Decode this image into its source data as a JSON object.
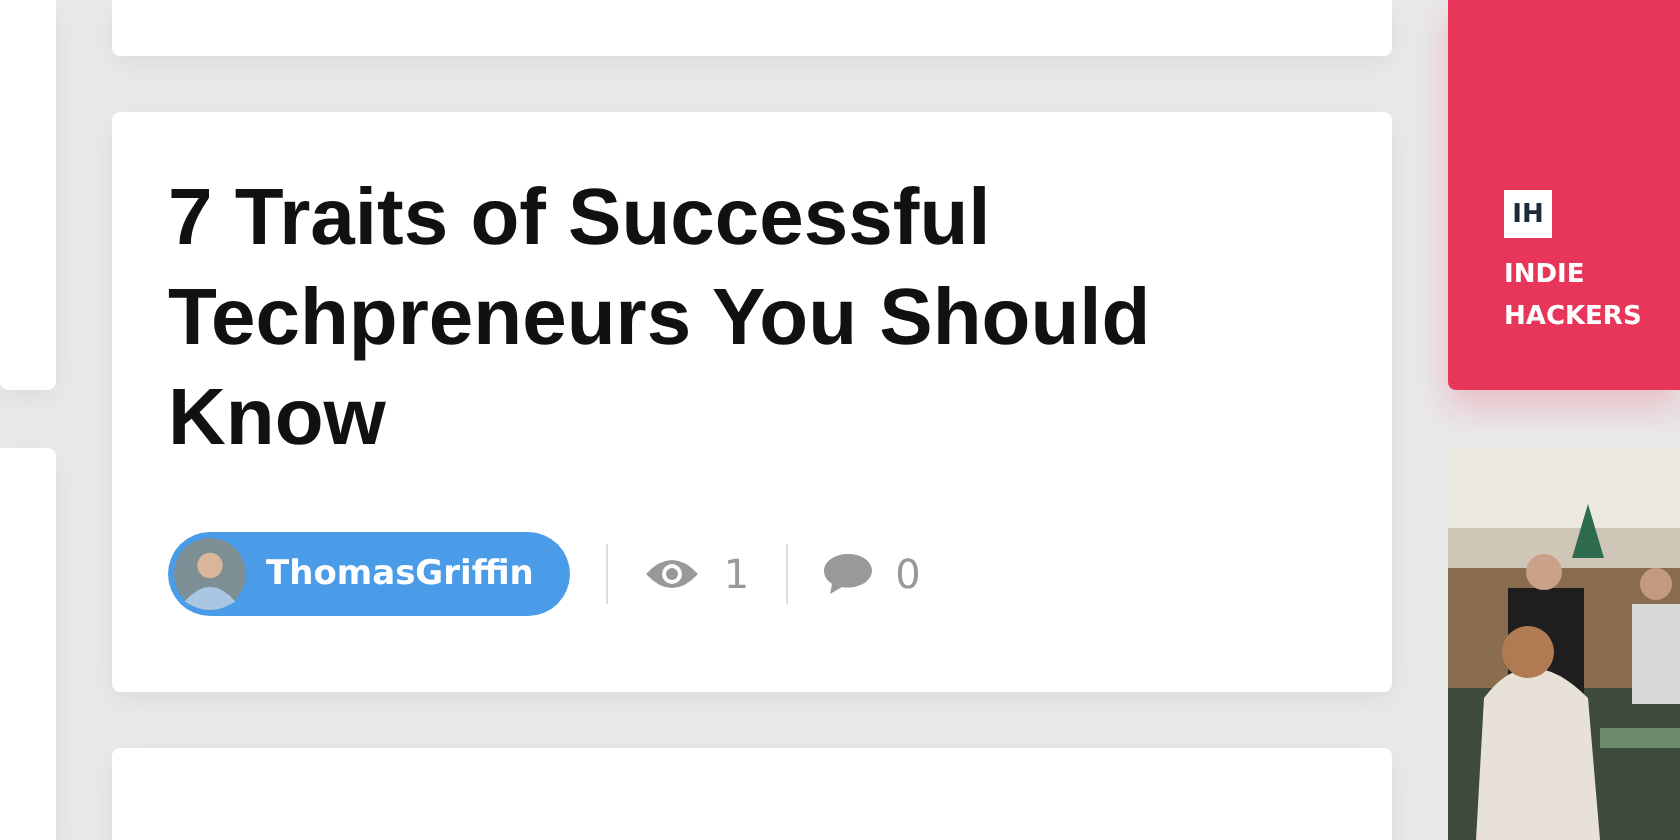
{
  "post": {
    "title": "7 Traits of Successful Techpreneurs You Should Know",
    "author": "ThomasGriffin",
    "views": "1",
    "comments": "0"
  },
  "sponsor": {
    "logo": "IH",
    "name": "INDIE HACKERS"
  }
}
